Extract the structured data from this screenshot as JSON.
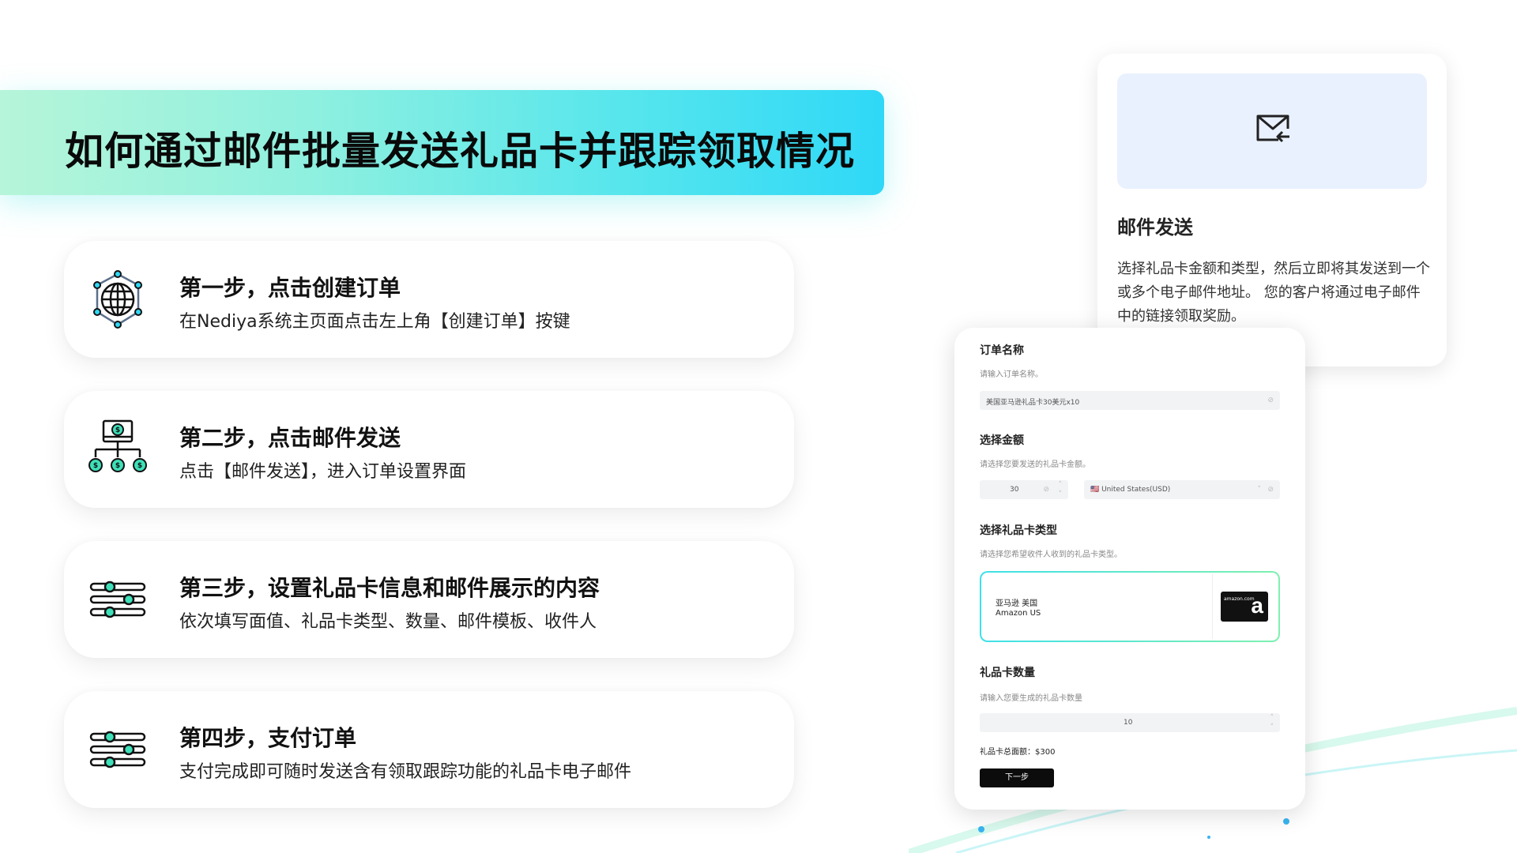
{
  "title": "如何通过邮件批量发送礼品卡并跟踪领取情况",
  "steps": [
    {
      "icon": "globe-network-icon",
      "title": "第一步，点击创建订单",
      "desc": "在Nediya系统主页面点击左上角【创建订单】按键"
    },
    {
      "icon": "monitor-distribution-icon",
      "title": "第二步，点击邮件发送",
      "desc": "点击【邮件发送】，进入订单设置界面"
    },
    {
      "icon": "sliders-icon",
      "title": "第三步，设置礼品卡信息和邮件展示的内容",
      "desc": "依次填写面值、礼品卡类型、数量、邮件模板、收件人"
    },
    {
      "icon": "sliders-icon",
      "title": "第四步，支付订单",
      "desc": "支付完成即可随时发送含有领取跟踪功能的礼品卡电子邮件"
    }
  ],
  "mail_card": {
    "icon": "mail-reply-icon",
    "title": "邮件发送",
    "desc": "选择礼品卡金额和类型，然后立即将其发送到一个或多个电子邮件地址。 您的客户将通过电子邮件中的链接领取奖励。"
  },
  "form": {
    "order_name": {
      "label": "订单名称",
      "hint": "请输入订单名称。",
      "value": "美国亚马逊礼品卡30美元x10"
    },
    "amount": {
      "label": "选择金额",
      "hint": "请选择您要发送的礼品卡金额。",
      "value": "30",
      "currency": "🇺🇸 United States(USD)"
    },
    "card_type": {
      "label": "选择礼品卡类型",
      "hint": "请选择您希望收件人收到的礼品卡类型。",
      "name_cn": "亚马逊 美国",
      "name_en": "Amazon US",
      "logo_text": "amazon.com",
      "logo_letter": "a"
    },
    "quantity": {
      "label": "礼品卡数量",
      "hint": "请输入您要生成的礼品卡数量",
      "value": "10"
    },
    "total": "礼品卡总面额：$300",
    "next_button": "下一步"
  },
  "colors": {
    "banner_start": "#b6f5d9",
    "banner_end": "#2fd8f7",
    "accent": "#3ee0e8"
  }
}
